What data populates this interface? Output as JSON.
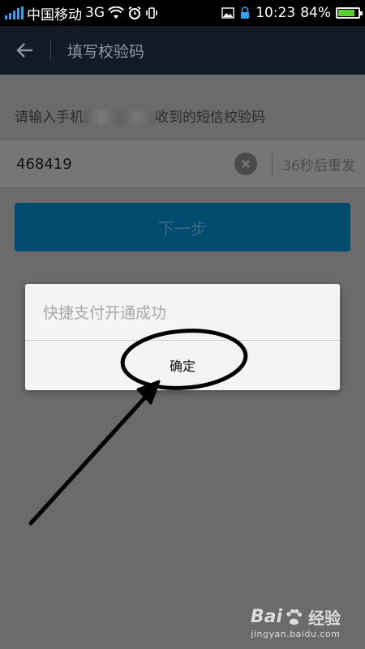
{
  "status_bar": {
    "carrier": "中国移动",
    "network": "3G",
    "time": "10:23",
    "battery": "84%",
    "battery_level": 0.84
  },
  "title_bar": {
    "title": "填写校验码"
  },
  "form": {
    "hint_prefix": "请输入手机",
    "hint_suffix": "收到的短信校验码",
    "code_value": "468419",
    "resend_label": "36秒后重发",
    "next_label": "下一步"
  },
  "dialog": {
    "message": "快捷支付开通成功",
    "confirm_label": "确定"
  },
  "watermark": {
    "brand": "Bai",
    "brand_suffix": "经验",
    "url": "jingyan.baidu.com"
  },
  "colors": {
    "status_bar_bg": "#000000",
    "title_bar_bg": "#111a25",
    "accent_button": "#004b6e",
    "battery_green": "#55d12e",
    "signal_blue": "#2ea3f2"
  }
}
